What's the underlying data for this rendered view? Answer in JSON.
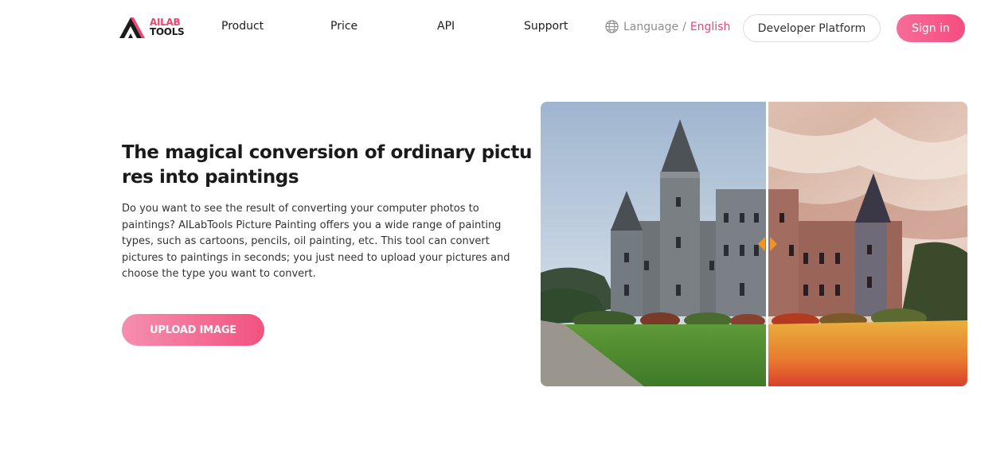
{
  "logo": {
    "line1": "AILAB",
    "line2": "TOOLS"
  },
  "nav": {
    "items": [
      {
        "label": "Product"
      },
      {
        "label": "Price"
      },
      {
        "label": "API"
      },
      {
        "label": "Support"
      }
    ],
    "language_label": "Language",
    "language_separator": "/",
    "language_current": "English",
    "developer_platform_label": "Developer Platform",
    "sign_in_label": "Sign in"
  },
  "hero": {
    "title": "The magical conversion of ordinary pictures into paintings",
    "description": "Do you want to see the result of converting your computer photos to paintings? AILabTools Picture Painting offers you a wide range of painting types, such as cartoons, pencils, oil painting, etc. This tool can convert pictures to paintings in seconds; you just need to upload your pictures and choose the type you want to convert.",
    "upload_label": "UPLOAD IMAGE"
  },
  "colors": {
    "accent": "#f54d7f",
    "language_current": "#e0467c"
  },
  "icons": {
    "language": "globe-icon",
    "compare_handle": "compare-handle-icon"
  }
}
